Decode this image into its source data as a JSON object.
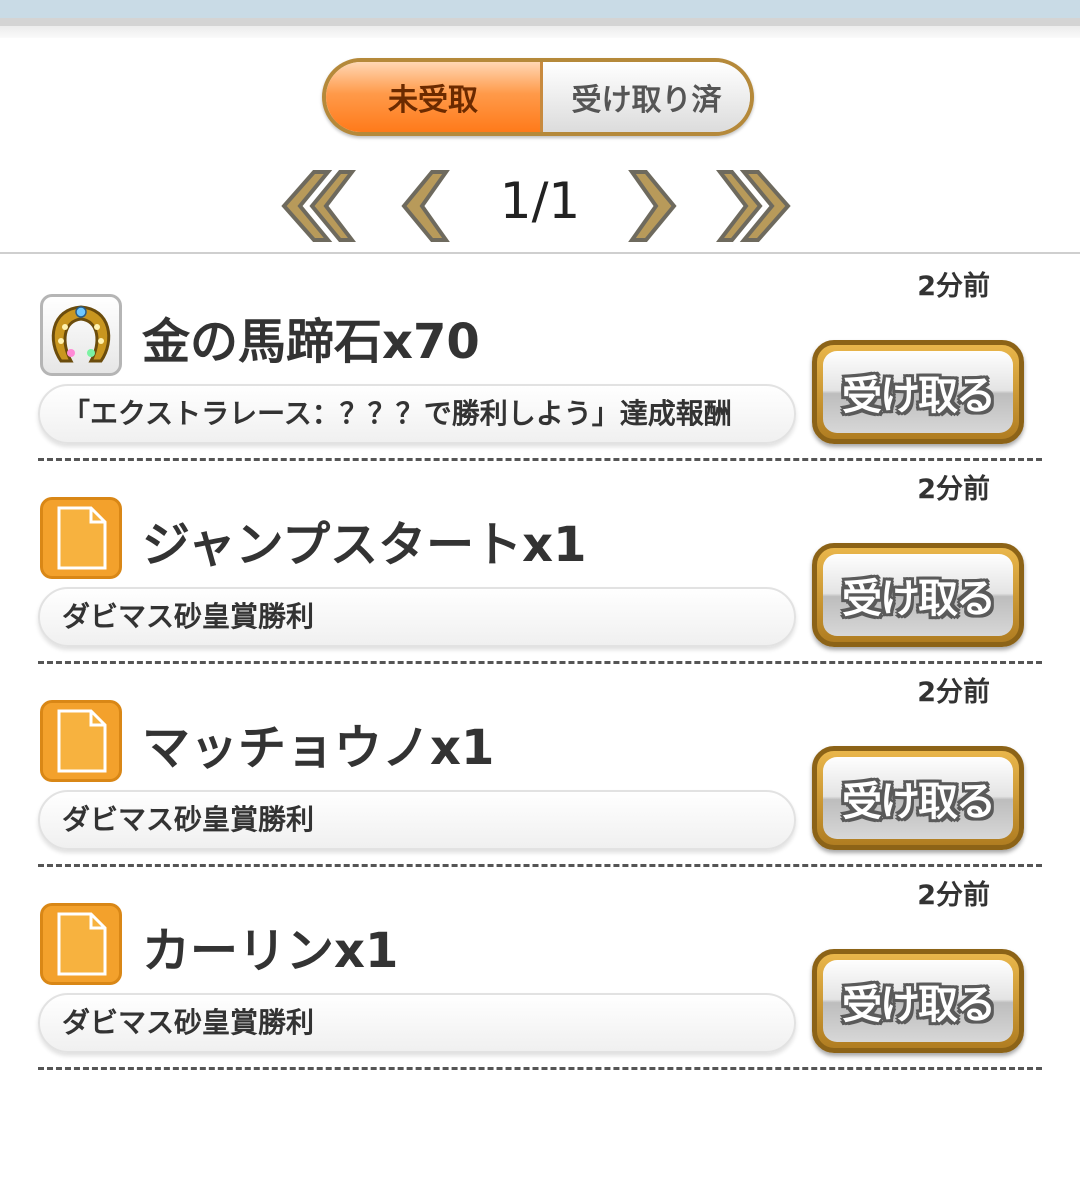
{
  "tabs": {
    "unclaimed": "未受取",
    "claimed": "受け取り済"
  },
  "pager": {
    "page": "1/1",
    "first_icon": "double-chevron-left-icon",
    "prev_icon": "chevron-left-icon",
    "next_icon": "chevron-right-icon",
    "last_icon": "double-chevron-right-icon"
  },
  "items": [
    {
      "time": "2分前",
      "icon": "horseshoe-icon",
      "title": "金の馬蹄石x70",
      "description": "「エクストラレース：？？？で勝利しよう」達成報酬",
      "button": "受け取る"
    },
    {
      "time": "2分前",
      "icon": "document-icon",
      "title": "ジャンプスタートx1",
      "description": "ダビマス砂皇賞勝利",
      "button": "受け取る"
    },
    {
      "time": "2分前",
      "icon": "document-icon",
      "title": "マッチョウノx1",
      "description": "ダビマス砂皇賞勝利",
      "button": "受け取る"
    },
    {
      "time": "2分前",
      "icon": "document-icon",
      "title": "カーリンx1",
      "description": "ダビマス砂皇賞勝利",
      "button": "受け取る"
    }
  ],
  "colors": {
    "accent_orange": "#ff7a1a",
    "button_gold": "#b07d21",
    "doc_icon_orange": "#f3a12c"
  }
}
